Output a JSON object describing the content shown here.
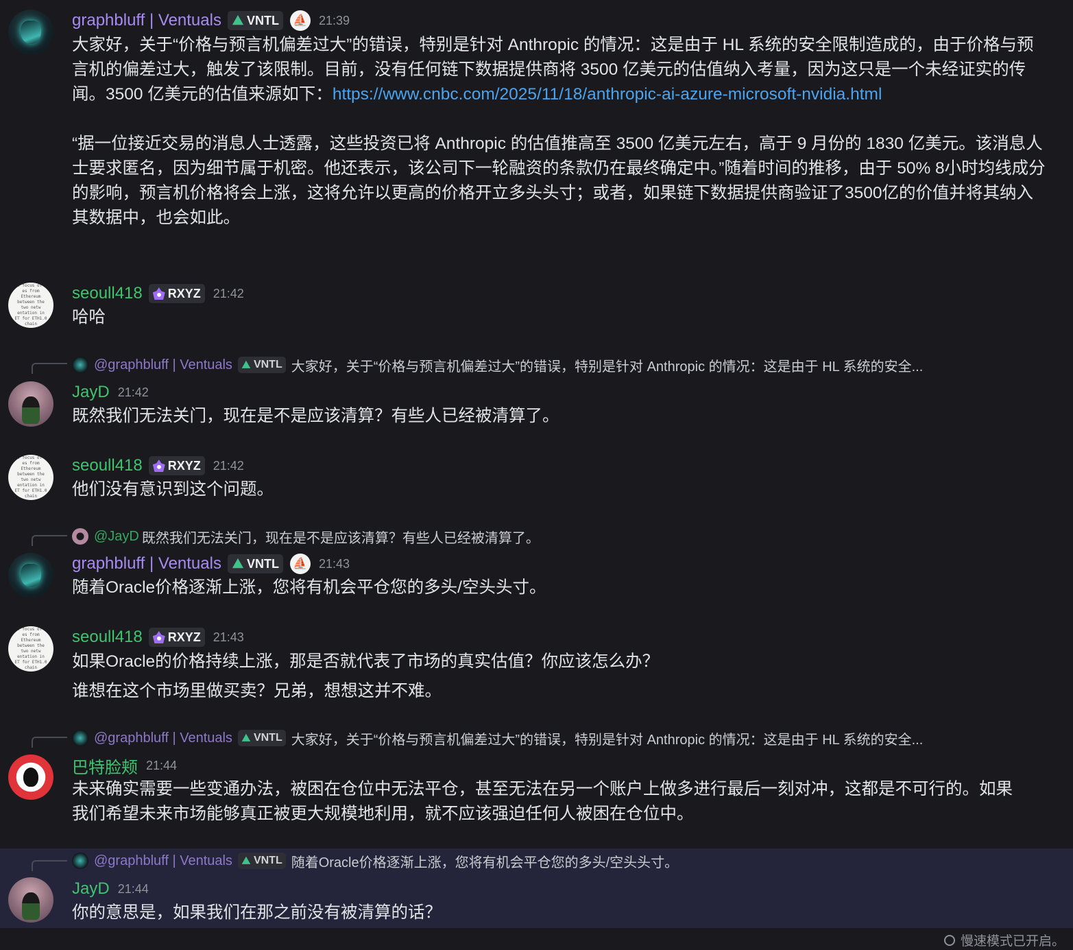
{
  "tags": {
    "vntl": "VNTL",
    "rxyz": "RXYZ"
  },
  "messages": [
    {
      "author": "graphbluff | Ventuals",
      "time": "21:39",
      "p1_before_link": "大家好，关于“价格与预言机偏差过大”的错误，特别是针对 Anthropic 的情况：这是由于 HL 系统的安全限制造成的，由于价格与预言机的偏差过大，触发了该限制。目前，没有任何链下数据提供商将 3500 亿美元的估值纳入考量，因为这只是一个未经证实的传闻。3500 亿美元的估值来源如下：",
      "link": "https://www.cnbc.com/2025/11/18/anthropic-ai-azure-microsoft-nvidia.html",
      "p2": "“据一位接近交易的消息人士透露，这些投资已将 Anthropic 的估值推高至 3500 亿美元左右，高于 9 月份的 1830 亿美元。该消息人士要求匿名，因为细节属于机密。他还表示，该公司下一轮融资的条款仍在最终确定中。”随着时间的推移，由于 50% 8小时均线成分的影响，预言机价格将会上涨，这将允许以更高的价格开立多头头寸；或者，如果链下数据提供商验证了3500亿的价值并将其纳入其数据中，也会如此。"
    },
    {
      "author": "seoull418",
      "time": "21:42",
      "text": "哈哈"
    },
    {
      "reply_name": "@graphbluff | Ventuals",
      "reply_text": "大家好，关于“价格与预言机偏差过大”的错误，特别是针对 Anthropic 的情况：这是由于 HL 系统的安全...",
      "author": "JayD",
      "time": "21:42",
      "text": "既然我们无法关门，现在是不是应该清算？有些人已经被清算了。"
    },
    {
      "author": "seoull418",
      "time": "21:42",
      "text": "他们没有意识到这个问题。"
    },
    {
      "reply_name": "@JayD",
      "reply_text": "既然我们无法关门，现在是不是应该清算？有些人已经被清算了。",
      "author": "graphbluff | Ventuals",
      "time": "21:43",
      "text": "随着Oracle价格逐渐上涨，您将有机会平仓您的多头/空头头寸。"
    },
    {
      "author": "seoull418",
      "time": "21:43",
      "text": "如果Oracle的价格持续上涨，那是否就代表了市场的真实估值？你应该怎么办？",
      "text2": "谁想在这个市场里做买卖？兄弟，想想这并不难。"
    },
    {
      "reply_name": "@graphbluff | Ventuals",
      "reply_text": "大家好，关于“价格与预言机偏差过大”的错误，特别是针对 Anthropic 的情况：这是由于 HL 系统的安全...",
      "author": "巴特脸颊",
      "time": "21:44",
      "text": "未来确实需要一些变通办法，被困在仓位中无法平仓，甚至无法在另一个账户上做多进行最后一刻对冲，这都是不可行的。如果我们希望未来市场能够真正被更大规模地利用，就不应该强迫任何人被困在仓位中。"
    },
    {
      "reply_name": "@graphbluff | Ventuals",
      "reply_text": "随着Oracle价格逐渐上涨，您将有机会平仓您的多头/空头头寸。",
      "author": "JayD",
      "time": "21:44",
      "text": "你的意思是，如果我们在那之前没有被清算的话？"
    }
  ],
  "avatar_text": "al focus of t\nes from Ethereum\nbetween the two netw\nentation, especially in ET\nfor ETH1.0 chain. The Ba\nthat there will be no\ne introduction of",
  "footer": {
    "slow_mode": "慢速模式已开启。"
  }
}
